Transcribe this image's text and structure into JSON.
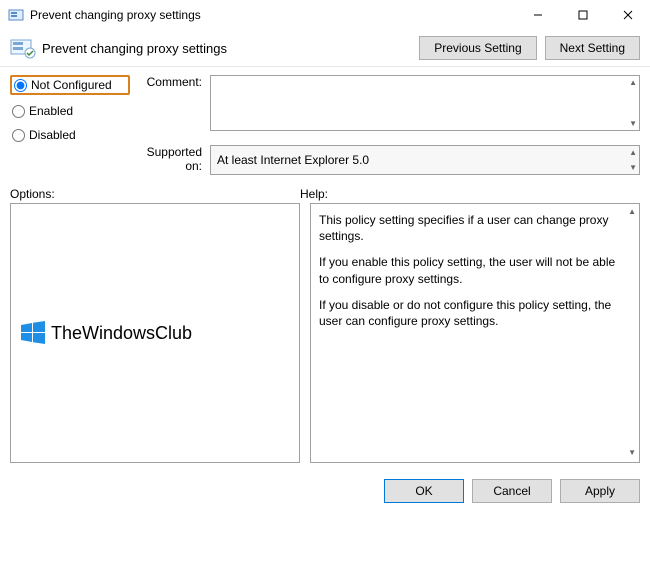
{
  "window": {
    "title": "Prevent changing proxy settings"
  },
  "header": {
    "label": "Prevent changing proxy settings"
  },
  "nav": {
    "previous": "Previous Setting",
    "next": "Next Setting"
  },
  "radios": {
    "not_configured": "Not Configured",
    "enabled": "Enabled",
    "disabled": "Disabled",
    "selected": "not_configured"
  },
  "labels": {
    "comment": "Comment:",
    "supported_on": "Supported on:",
    "options": "Options:",
    "help": "Help:"
  },
  "fields": {
    "comment": "",
    "supported_on": "At least Internet Explorer 5.0"
  },
  "help": {
    "p1": "This policy setting specifies if a user can change proxy settings.",
    "p2": "If you enable this policy setting, the user will not be able to configure proxy settings.",
    "p3": "If you disable or do not configure this policy setting, the user can configure proxy settings."
  },
  "watermark": "TheWindowsClub",
  "buttons": {
    "ok": "OK",
    "cancel": "Cancel",
    "apply": "Apply"
  }
}
